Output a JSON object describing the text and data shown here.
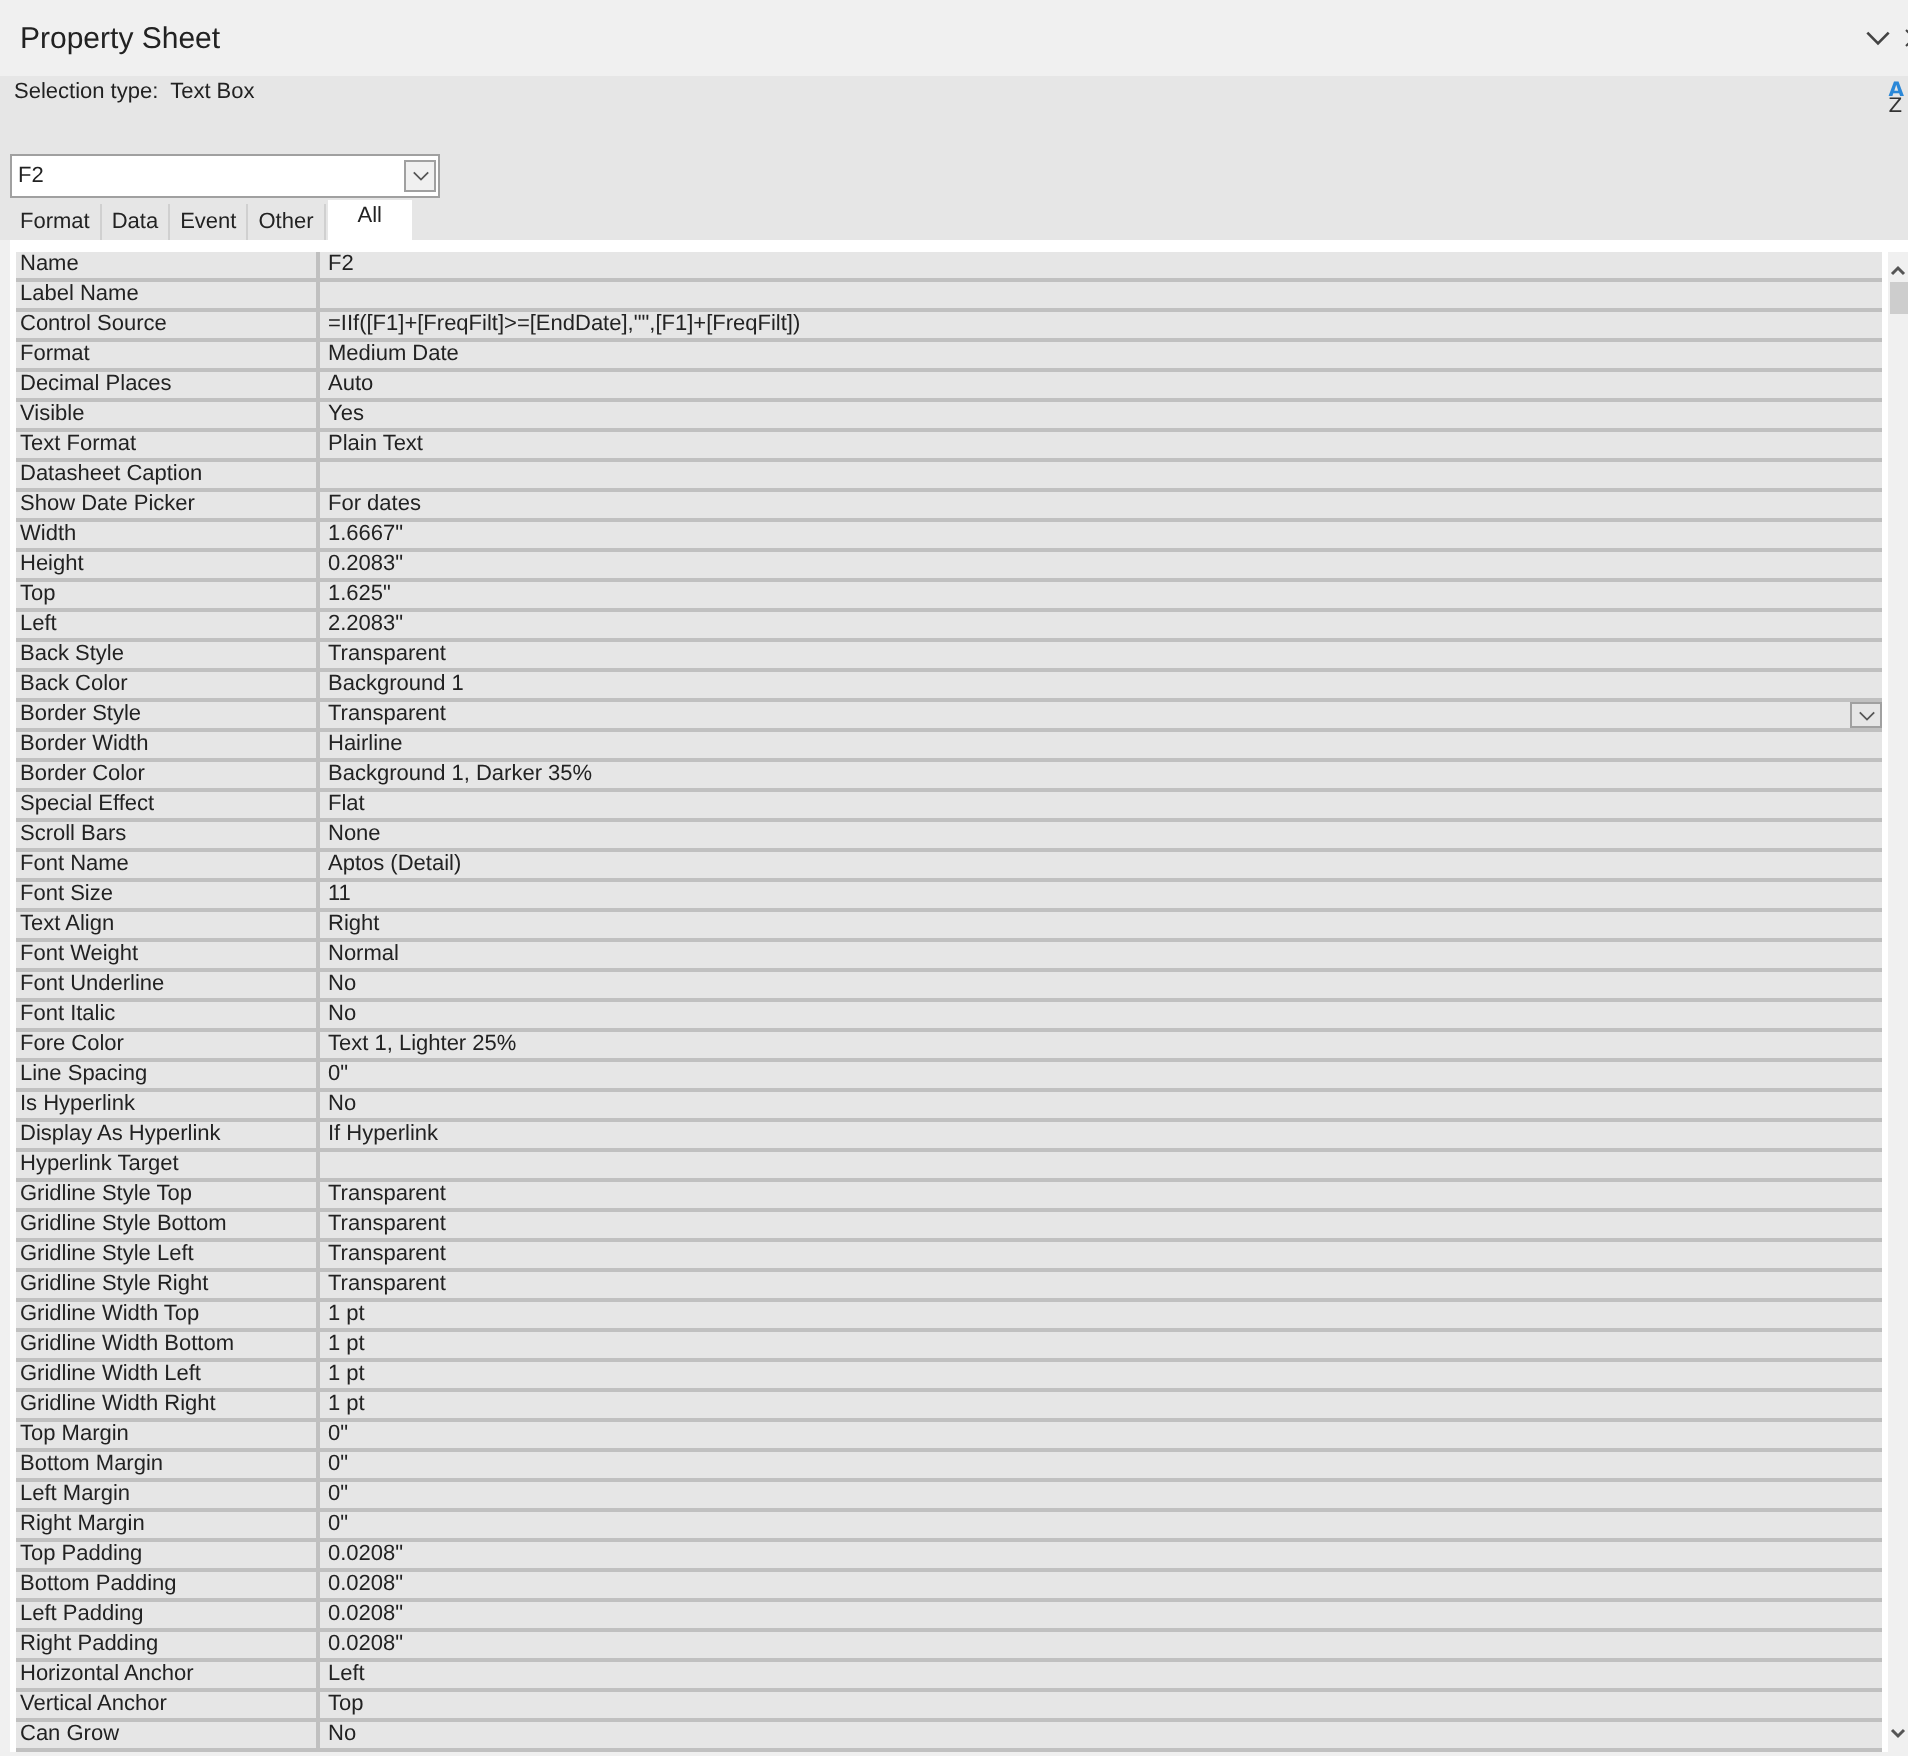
{
  "window": {
    "title": "Property Sheet"
  },
  "selection_type": {
    "label": "Selection type:",
    "value": "Text Box"
  },
  "sort_button": {
    "top": "A",
    "bottom": "Z"
  },
  "object_selector": {
    "value": "F2"
  },
  "tabs": [
    {
      "label": "Format",
      "selected": false
    },
    {
      "label": "Data",
      "selected": false
    },
    {
      "label": "Event",
      "selected": false
    },
    {
      "label": "Other",
      "selected": false
    },
    {
      "label": "All",
      "selected": true
    }
  ],
  "properties": [
    {
      "name": "Name",
      "value": "F2",
      "selected": false
    },
    {
      "name": "Label Name",
      "selected": false
    },
    {
      "name": "Control Source",
      "value": "=IIf([F1]+[FreqFilt]>=[EndDate],\"\",[F1]+[FreqFilt])",
      "selected": false
    },
    {
      "name": "Format",
      "value": "Medium Date",
      "selected": false
    },
    {
      "name": "Decimal Places",
      "value": "Auto",
      "selected": false
    },
    {
      "name": "Visible",
      "value": "Yes",
      "selected": false
    },
    {
      "name": "Text Format",
      "value": "Plain Text",
      "selected": false
    },
    {
      "name": "Datasheet Caption",
      "selected": false
    },
    {
      "name": "Show Date Picker",
      "value": "For dates",
      "selected": false
    },
    {
      "name": "Width",
      "value": "1.6667\"",
      "selected": false
    },
    {
      "name": "Height",
      "value": "0.2083\"",
      "selected": false
    },
    {
      "name": "Top",
      "value": "1.625\"",
      "selected": false
    },
    {
      "name": "Left",
      "value": "2.2083\"",
      "selected": false
    },
    {
      "name": "Back Style",
      "value": "Transparent",
      "selected": false
    },
    {
      "name": "Back Color",
      "value": "Background 1",
      "selected": false
    },
    {
      "name": "Border Style",
      "value": "Transparent",
      "selected": true
    },
    {
      "name": "Border Width",
      "value": "Hairline",
      "selected": false
    },
    {
      "name": "Border Color",
      "value": "Background 1, Darker 35%",
      "selected": false
    },
    {
      "name": "Special Effect",
      "value": "Flat",
      "selected": false
    },
    {
      "name": "Scroll Bars",
      "value": "None",
      "selected": false
    },
    {
      "name": "Font Name",
      "value": "Aptos (Detail)",
      "selected": false
    },
    {
      "name": "Font Size",
      "value": "11",
      "selected": false
    },
    {
      "name": "Text Align",
      "value": "Right",
      "selected": false
    },
    {
      "name": "Font Weight",
      "value": "Normal",
      "selected": false
    },
    {
      "name": "Font Underline",
      "value": "No",
      "selected": false
    },
    {
      "name": "Font Italic",
      "value": "No",
      "selected": false
    },
    {
      "name": "Fore Color",
      "value": "Text 1, Lighter 25%",
      "selected": false
    },
    {
      "name": "Line Spacing",
      "value": "0\"",
      "selected": false
    },
    {
      "name": "Is Hyperlink",
      "value": "No",
      "selected": false
    },
    {
      "name": "Display As Hyperlink",
      "value": "If Hyperlink",
      "selected": false
    },
    {
      "name": "Hyperlink Target",
      "selected": false
    },
    {
      "name": "Gridline Style Top",
      "value": "Transparent",
      "selected": false
    },
    {
      "name": "Gridline Style Bottom",
      "value": "Transparent",
      "selected": false
    },
    {
      "name": "Gridline Style Left",
      "value": "Transparent",
      "selected": false
    },
    {
      "name": "Gridline Style Right",
      "value": "Transparent",
      "selected": false
    },
    {
      "name": "Gridline Width Top",
      "value": "1 pt",
      "selected": false
    },
    {
      "name": "Gridline Width Bottom",
      "value": "1 pt",
      "selected": false
    },
    {
      "name": "Gridline Width Left",
      "value": "1 pt",
      "selected": false
    },
    {
      "name": "Gridline Width Right",
      "value": "1 pt",
      "selected": false
    },
    {
      "name": "Top Margin",
      "value": "0\"",
      "selected": false
    },
    {
      "name": "Bottom Margin",
      "value": "0\"",
      "selected": false
    },
    {
      "name": "Left Margin",
      "value": "0\"",
      "selected": false
    },
    {
      "name": "Right Margin",
      "value": "0\"",
      "selected": false
    },
    {
      "name": "Top Padding",
      "value": "0.0208\"",
      "selected": false
    },
    {
      "name": "Bottom Padding",
      "value": "0.0208\"",
      "selected": false
    },
    {
      "name": "Left Padding",
      "value": "0.0208\"",
      "selected": false
    },
    {
      "name": "Right Padding",
      "value": "0.0208\"",
      "selected": false
    },
    {
      "name": "Horizontal Anchor",
      "value": "Left",
      "selected": false
    },
    {
      "name": "Vertical Anchor",
      "value": "Top",
      "selected": false
    },
    {
      "name": "Can Grow",
      "value": "No",
      "selected": false
    }
  ]
}
